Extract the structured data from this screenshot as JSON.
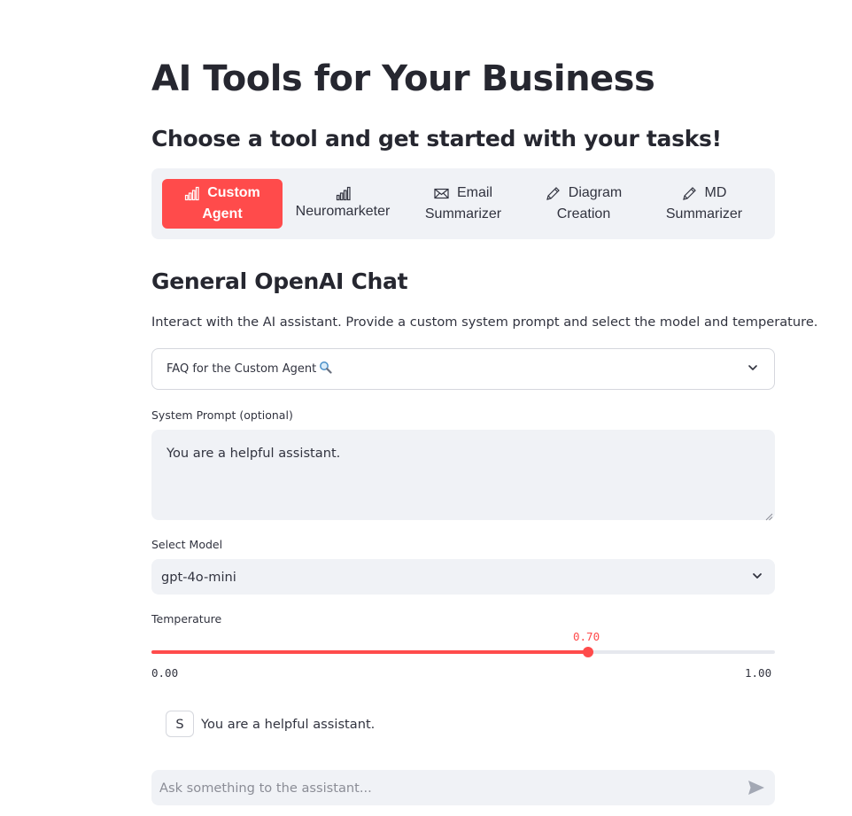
{
  "header": {
    "title": "AI Tools for Your Business",
    "subtitle": "Choose a tool and get started with your tasks!"
  },
  "tools": [
    {
      "icon": "bar-chart-icon",
      "line1": "Custom",
      "line2": "Agent",
      "active": true
    },
    {
      "icon": "bar-chart-icon",
      "line1": "",
      "line2": "Neuromarketer",
      "active": false
    },
    {
      "icon": "envelope-icon",
      "line1": "Email",
      "line2": "Summarizer",
      "active": false
    },
    {
      "icon": "pencil-icon",
      "line1": "Diagram",
      "line2": "Creation",
      "active": false
    },
    {
      "icon": "pencil-icon",
      "line1": "MD",
      "line2": "Summarizer",
      "active": false
    }
  ],
  "section": {
    "title": "General OpenAI Chat",
    "description": "Interact with the AI assistant. Provide a custom system prompt and select the model and temperature."
  },
  "faq": {
    "label": "FAQ for the Custom Agent",
    "icon": "magnifier-icon"
  },
  "system_prompt": {
    "label": "System Prompt (optional)",
    "value": "You are a helpful assistant."
  },
  "model": {
    "label": "Select Model",
    "selected": "gpt-4o-mini"
  },
  "temperature": {
    "label": "Temperature",
    "value_text": "0.70",
    "value": 0.7,
    "min_text": "0.00",
    "max_text": "1.00"
  },
  "chat": {
    "avatar_letter": "S",
    "message": "You are a helpful assistant.",
    "input_placeholder": "Ask something to the assistant..."
  },
  "colors": {
    "accent": "#ff4b4b",
    "panel_bg": "#f0f2f6",
    "text": "#31333f"
  }
}
